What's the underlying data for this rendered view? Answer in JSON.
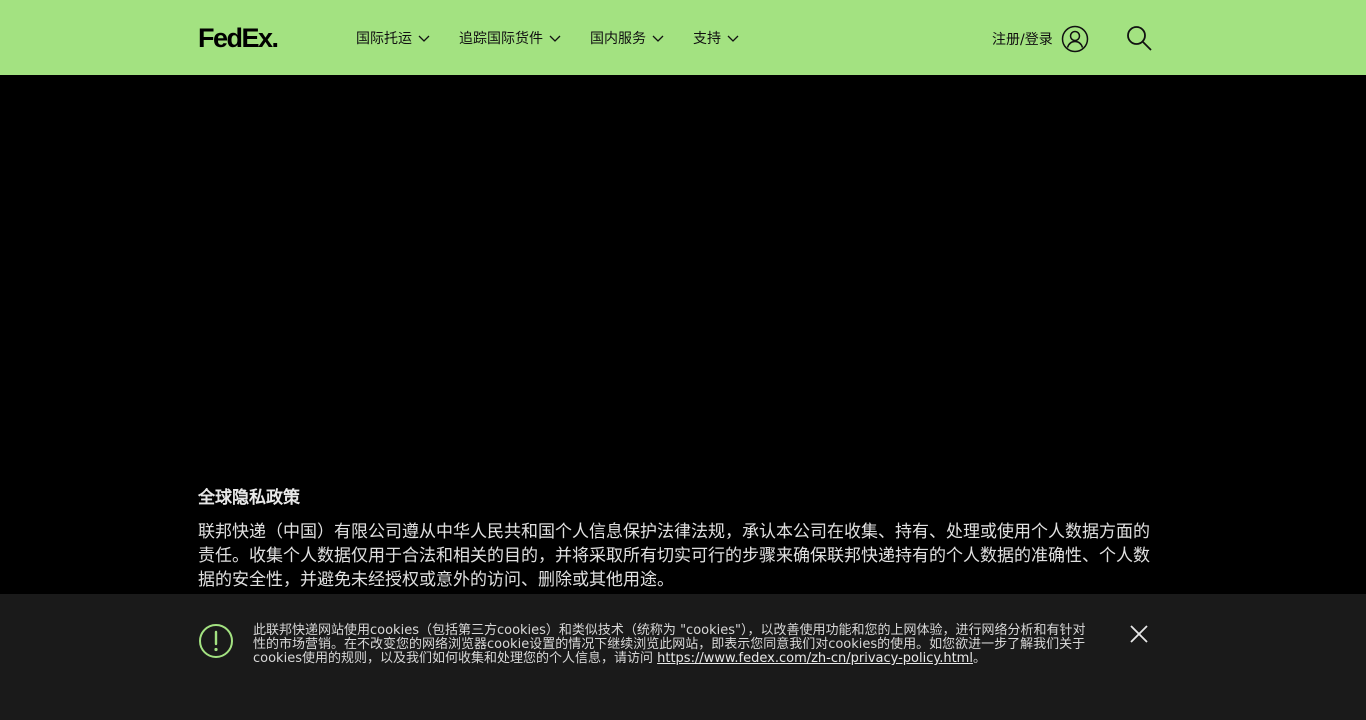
{
  "header": {
    "logo_text_fed": "Fed",
    "logo_text_ex": "Ex",
    "logo_dot": ".",
    "nav": [
      {
        "label": "国际托运"
      },
      {
        "label": "追踪国际货件"
      },
      {
        "label": "国内服务"
      },
      {
        "label": "支持"
      }
    ],
    "login_label": "注册/登录"
  },
  "main": {
    "title": "全球隐私政策",
    "paragraph": "联邦快递（中国）有限公司遵从中华人民共和国个人信息保护法律法规，承认本公司在收集、持有、处理或使用个人数据方面的责任。收集个人数据仅用于合法和相关的目的，并将采取所有切实可行的步骤来确保联邦快递持有的个人数据的准确性、个人数据的安全性，并避免未经授权或意外的访问、删除或其他用途。"
  },
  "cookie_banner": {
    "text": "此联邦快递网站使用cookies（包括第三方cookies）和类似技术（统称为 \"cookies\"），以改善使用功能和您的上网体验，进行网络分析和有针对性的市场营销。在不改变您的网络浏览器cookie设置的情况下继续浏览此网站，即表示您同意我们对cookies的使用。如您欲进一步了解我们关于cookies使用的规则，以及我们如何收集和处理您的个人信息，请访问 ",
    "link_text": "https://www.fedex.com/zh-cn/privacy-policy.html",
    "suffix": "。"
  },
  "colors": {
    "header_bg": "#a3e281",
    "page_bg": "#000000",
    "banner_bg": "#1a1a1a",
    "alert_accent": "#a3e281"
  },
  "icons": [
    "chevron-down-icon",
    "user-icon",
    "search-icon",
    "alert-icon",
    "close-icon"
  ]
}
